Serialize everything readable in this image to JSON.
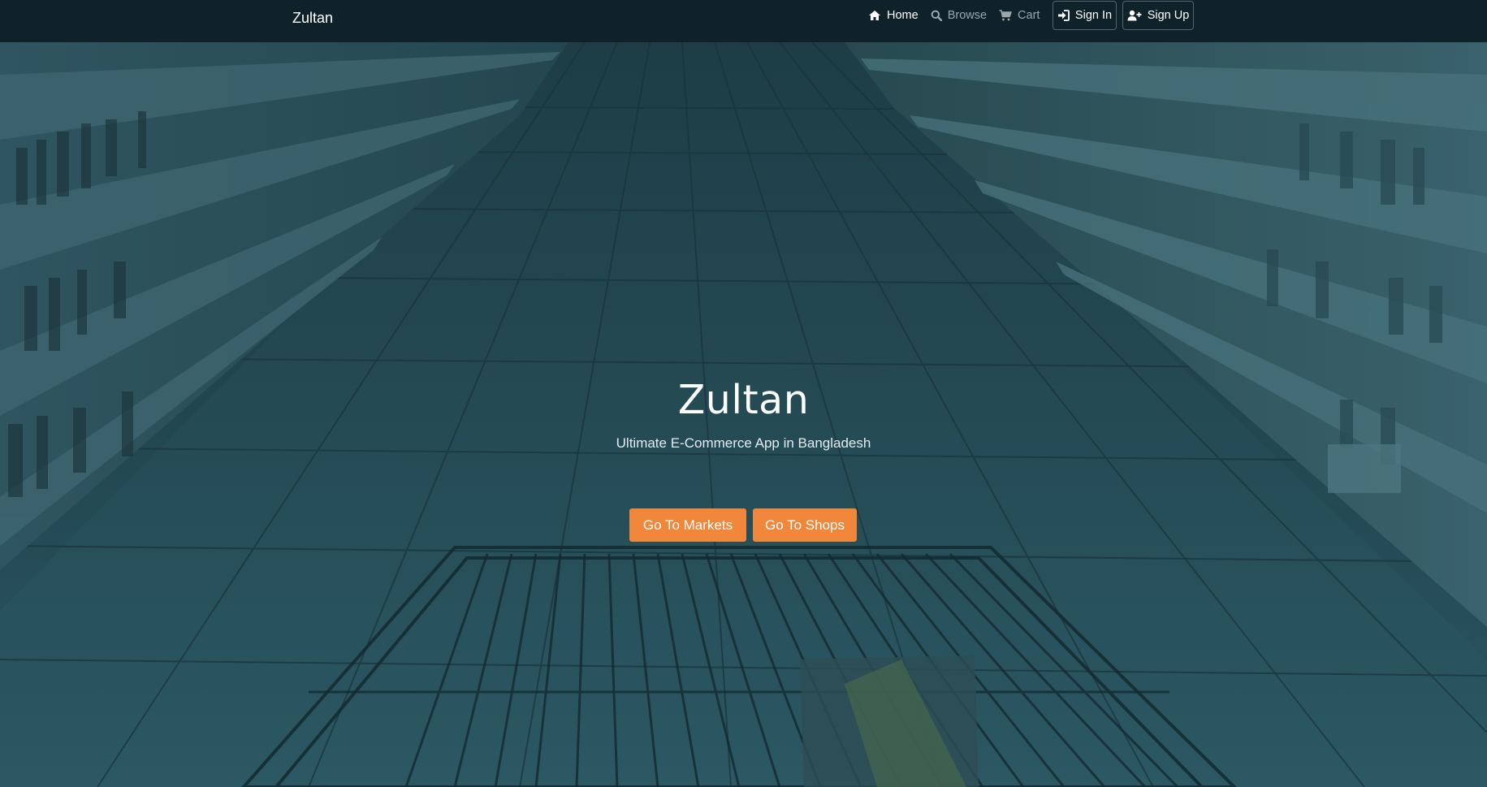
{
  "brand": "Zultan",
  "nav": {
    "home": {
      "label": "Home",
      "icon": "home-icon"
    },
    "browse": {
      "label": "Browse",
      "icon": "search-icon"
    },
    "cart": {
      "label": "Cart",
      "icon": "cart-icon"
    }
  },
  "auth": {
    "sign_in": {
      "label": "Sign In",
      "icon": "sign-in-icon"
    },
    "sign_up": {
      "label": "Sign Up",
      "icon": "user-plus-icon"
    }
  },
  "hero": {
    "title": "Zultan",
    "subtitle": "Ultimate E-Commerce App in Bangladesh",
    "buttons": {
      "markets": "Go To Markets",
      "shops": "Go To Shops"
    }
  },
  "colors": {
    "navbar": "#0f2229",
    "accent": "#f0873a",
    "overlay": "#21454f"
  }
}
